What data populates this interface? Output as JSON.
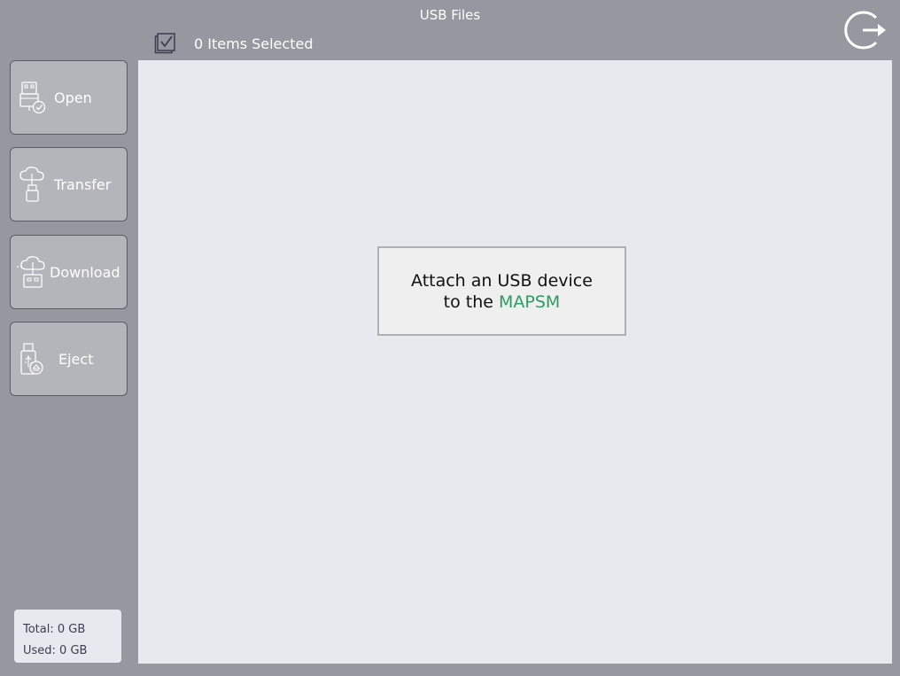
{
  "header": {
    "title": "USB Files"
  },
  "selection": {
    "count_text": "0 Items Selected"
  },
  "sidebar": {
    "buttons": [
      {
        "label": "Open",
        "icon": "usb-open-icon"
      },
      {
        "label": "Transfer",
        "icon": "cloud-transfer-icon"
      },
      {
        "label": "Download",
        "icon": "cloud-download-icon"
      },
      {
        "label": "Eject",
        "icon": "usb-eject-icon"
      }
    ]
  },
  "storage": {
    "total": "Total: 0 GB",
    "used": "Used: 0 GB"
  },
  "empty_state": {
    "line1": "Attach an USB device",
    "line2_prefix": "to the ",
    "line2_accent": "MAPSM"
  },
  "colors": {
    "background": "#96979f",
    "panel": "#e8e9ee",
    "accent": "#2e9c62"
  }
}
